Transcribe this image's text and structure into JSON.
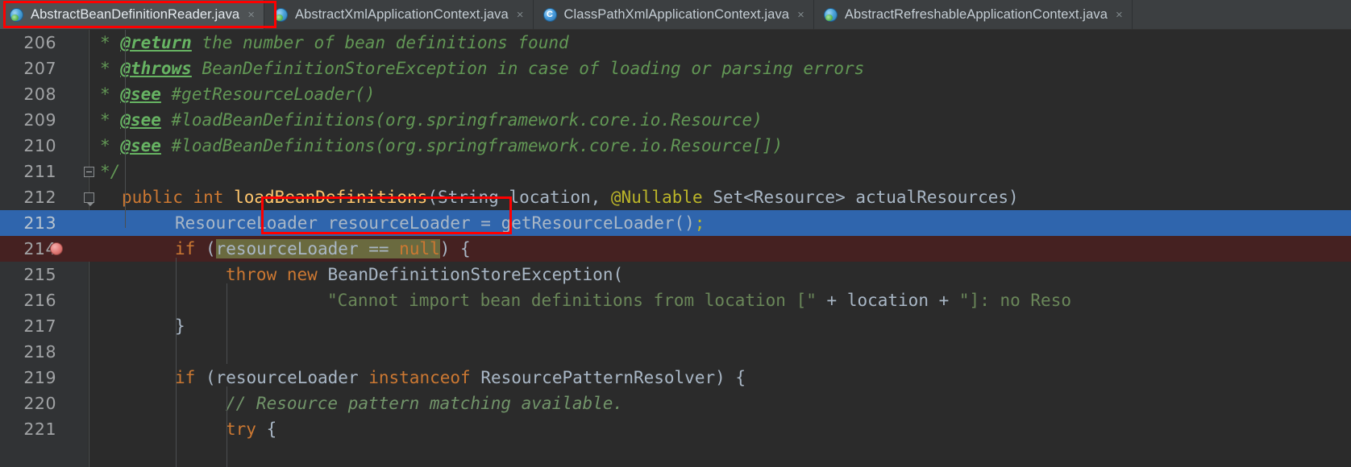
{
  "window": {
    "app": "IntelliJ IDEA Editor",
    "theme_bg": "#2b2b2b",
    "annotation_color": "#fe0000"
  },
  "tabs": [
    {
      "label": "AbstractBeanDefinitionReader.java",
      "icon": "abstract-class-icon",
      "active": true,
      "close": "×",
      "highlighted": true
    },
    {
      "label": "AbstractXmlApplicationContext.java",
      "icon": "abstract-class-icon",
      "active": false,
      "close": "×",
      "highlighted": false
    },
    {
      "label": "ClassPathXmlApplicationContext.java",
      "icon": "class-icon",
      "active": false,
      "close": "×",
      "highlighted": false
    },
    {
      "label": "AbstractRefreshableApplicationContext.java",
      "icon": "abstract-class-icon",
      "active": false,
      "close": "×",
      "highlighted": false
    }
  ],
  "editor": {
    "first_line": 206,
    "selected_line": 213,
    "breakpoint_line": 214,
    "highlighted_token": "loadBeanDefinitions",
    "lines": [
      {
        "n": "206",
        "text": " * @return the number of bean definitions found"
      },
      {
        "n": "207",
        "text": " * @throws BeanDefinitionStoreException in case of loading or parsing errors"
      },
      {
        "n": "208",
        "text": " * @see #getResourceLoader()"
      },
      {
        "n": "209",
        "text": " * @see #loadBeanDefinitions(org.springframework.core.io.Resource)"
      },
      {
        "n": "210",
        "text": " * @see #loadBeanDefinitions(org.springframework.core.io.Resource[])"
      },
      {
        "n": "211",
        "text": " */"
      },
      {
        "n": "212",
        "text": "public int loadBeanDefinitions(String location, @Nullable Set<Resource> actualResources)"
      },
      {
        "n": "213",
        "text": "    ResourceLoader resourceLoader = getResourceLoader();"
      },
      {
        "n": "214",
        "text": "    if (resourceLoader == null) {"
      },
      {
        "n": "215",
        "text": "        throw new BeanDefinitionStoreException("
      },
      {
        "n": "216",
        "text": "                \"Cannot import bean definitions from location [\" + location + \"]: no Reso"
      },
      {
        "n": "217",
        "text": "    }"
      },
      {
        "n": "218",
        "text": ""
      },
      {
        "n": "219",
        "text": "    if (resourceLoader instanceof ResourcePatternResolver) {"
      },
      {
        "n": "220",
        "text": "        // Resource pattern matching available."
      },
      {
        "n": "221",
        "text": "        try {"
      }
    ],
    "tokens": {
      "doc_star": "*",
      "tag_return": "@return",
      "tag_throws": "@throws",
      "tag_see": "@see",
      "doc_return_text": " the number of bean definitions found",
      "doc_throws_text": " BeanDefinitionStoreException in case of loading or parsing errors",
      "doc_see_1": " #getResourceLoader()",
      "doc_see_2": " #loadBeanDefinitions(org.springframework.core.io.Resource)",
      "doc_see_3": " #loadBeanDefinitions(org.springframework.core.io.Resource[])",
      "doc_end": "*/",
      "kw_public": "public",
      "kw_int": "int",
      "method_name": "loadBeanDefinitions",
      "sig_rest_a": "(String location, ",
      "anno_nullable": "@Nullable",
      "sig_rest_b": " Set<Resource> actualResources)",
      "l213_a": "ResourceLoader resourceLoader = getResourceLoader()",
      "l213_b": ";",
      "kw_if": "if",
      "l214_open": " (",
      "l214_expr": "resourceLoader == ",
      "kw_null": "null",
      "l214_close": ") {",
      "kw_throw": "throw",
      "kw_new": "new",
      "l215_rest": " BeanDefinitionStoreException(",
      "l216_str": "\"Cannot import bean definitions from location [\"",
      "l216_plus1": " + ",
      "l216_loc": "location",
      "l216_plus2": " + ",
      "l216_str2": "\"]: no Reso",
      "l217": "}",
      "l219_a": " (resourceLoader ",
      "kw_instanceof": "instanceof",
      "l219_b": " ResourcePatternResolver) {",
      "l220_comment": "// Resource pattern matching available.",
      "kw_try": "try",
      "l221_rest": " {"
    }
  }
}
